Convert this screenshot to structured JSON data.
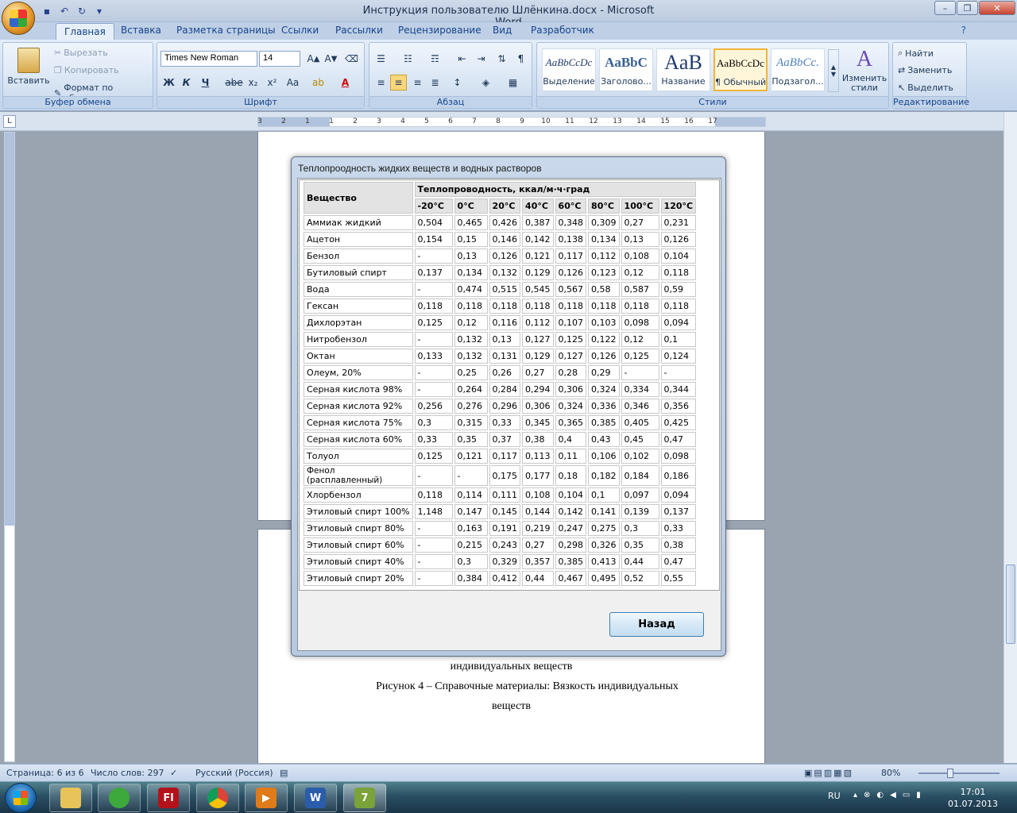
{
  "window": {
    "title": "Инструкция пользователю Шлёнкина.docx - Microsoft Word"
  },
  "tabs": [
    "Главная",
    "Вставка",
    "Разметка страницы",
    "Ссылки",
    "Рассылки",
    "Рецензирование",
    "Вид",
    "Разработчик"
  ],
  "ribbon": {
    "clipboard": {
      "label": "Буфер обмена",
      "paste": "Вставить",
      "cut": "Вырезать",
      "copy": "Копировать",
      "format_painter": "Формат по образцу"
    },
    "font": {
      "label": "Шрифт",
      "family": "Times New Roman",
      "size": "14"
    },
    "paragraph": {
      "label": "Абзац"
    },
    "styles": {
      "label": "Стили",
      "items": [
        {
          "preview": "AaBbCcDc",
          "name": "Выделение"
        },
        {
          "preview": "AaBbC",
          "name": "Заголово..."
        },
        {
          "preview": "AaB",
          "name": "Название"
        },
        {
          "preview": "AaBbCcDc",
          "name": "¶ Обычный"
        },
        {
          "preview": "AaBbCc.",
          "name": "Подзагол..."
        }
      ],
      "change": "Изменить стили"
    },
    "editing": {
      "label": "Редактирование",
      "find": "Найти",
      "replace": "Заменить",
      "select": "Выделить"
    }
  },
  "ruler": {
    "h_ticks": [
      "3",
      "2",
      "1",
      "1",
      "2",
      "3",
      "4",
      "5",
      "6",
      "7",
      "8",
      "9",
      "10",
      "11",
      "12",
      "13",
      "14",
      "15",
      "16",
      "17"
    ],
    "corner": "L"
  },
  "document": {
    "caption_line1": "индивидуальных веществ",
    "caption_line2": "Рисунок 4 – Справочные материалы: Вязкость индивидуальных",
    "caption_line3": "веществ"
  },
  "dialog": {
    "title": "Теплопроодность жидких веществ и водных растворов",
    "col_substance": "Вещество",
    "col_group": "Теплопроводность, ккал/м·ч·град",
    "temps": [
      "-20°C",
      "0°C",
      "20°C",
      "40°C",
      "60°C",
      "80°C",
      "100°C",
      "120°C"
    ],
    "rows": [
      {
        "name": "Аммиак жидкий",
        "v": [
          "0,504",
          "0,465",
          "0,426",
          "0,387",
          "0,348",
          "0,309",
          "0,27",
          "0,231"
        ]
      },
      {
        "name": "Ацетон",
        "v": [
          "0,154",
          "0,15",
          "0,146",
          "0,142",
          "0,138",
          "0,134",
          "0,13",
          "0,126"
        ]
      },
      {
        "name": "Бензол",
        "v": [
          "-",
          "0,13",
          "0,126",
          "0,121",
          "0,117",
          "0,112",
          "0,108",
          "0,104"
        ]
      },
      {
        "name": "Бутиловый спирт",
        "v": [
          "0,137",
          "0,134",
          "0,132",
          "0,129",
          "0,126",
          "0,123",
          "0,12",
          "0,118"
        ]
      },
      {
        "name": "Вода",
        "v": [
          "-",
          "0,474",
          "0,515",
          "0,545",
          "0,567",
          "0,58",
          "0,587",
          "0,59"
        ]
      },
      {
        "name": "Гексан",
        "v": [
          "0,118",
          "0,118",
          "0,118",
          "0,118",
          "0,118",
          "0,118",
          "0,118",
          "0,118"
        ]
      },
      {
        "name": "Дихлорэтан",
        "v": [
          "0,125",
          "0,12",
          "0,116",
          "0,112",
          "0,107",
          "0,103",
          "0,098",
          "0,094"
        ]
      },
      {
        "name": "Нитробензол",
        "v": [
          "-",
          "0,132",
          "0,13",
          "0,127",
          "0,125",
          "0,122",
          "0,12",
          "0,1"
        ]
      },
      {
        "name": "Октан",
        "v": [
          "0,133",
          "0,132",
          "0,131",
          "0,129",
          "0,127",
          "0,126",
          "0,125",
          "0,124"
        ]
      },
      {
        "name": "Олеум, 20%",
        "v": [
          "-",
          "0,25",
          "0,26",
          "0,27",
          "0,28",
          "0,29",
          "-",
          "-"
        ]
      },
      {
        "name": "Серная кислота 98%",
        "v": [
          "-",
          "0,264",
          "0,284",
          "0,294",
          "0,306",
          "0,324",
          "0,334",
          "0,344"
        ]
      },
      {
        "name": "Серная кислота 92%",
        "v": [
          "0,256",
          "0,276",
          "0,296",
          "0,306",
          "0,324",
          "0,336",
          "0,346",
          "0,356"
        ]
      },
      {
        "name": "Серная кислота 75%",
        "v": [
          "0,3",
          "0,315",
          "0,33",
          "0,345",
          "0,365",
          "0,385",
          "0,405",
          "0,425"
        ]
      },
      {
        "name": "Серная кислота 60%",
        "v": [
          "0,33",
          "0,35",
          "0,37",
          "0,38",
          "0,4",
          "0,43",
          "0,45",
          "0,47"
        ]
      },
      {
        "name": "Толуол",
        "v": [
          "0,125",
          "0,121",
          "0,117",
          "0,113",
          "0,11",
          "0,106",
          "0,102",
          "0,098"
        ]
      },
      {
        "name": "Фенол\n(расплавленный)",
        "v": [
          "-",
          "-",
          "0,175",
          "0,177",
          "0,18",
          "0,182",
          "0,184",
          "0,186"
        ]
      },
      {
        "name": "Хлорбензол",
        "v": [
          "0,118",
          "0,114",
          "0,111",
          "0,108",
          "0,104",
          "0,1",
          "0,097",
          "0,094"
        ]
      },
      {
        "name": "Этиловый спирт 100%",
        "v": [
          "1,148",
          "0,147",
          "0,145",
          "0,144",
          "0,142",
          "0,141",
          "0,139",
          "0,137"
        ]
      },
      {
        "name": "Этиловый спирт 80%",
        "v": [
          "-",
          "0,163",
          "0,191",
          "0,219",
          "0,247",
          "0,275",
          "0,3",
          "0,33"
        ]
      },
      {
        "name": "Этиловый спирт 60%",
        "v": [
          "-",
          "0,215",
          "0,243",
          "0,27",
          "0,298",
          "0,326",
          "0,35",
          "0,38"
        ]
      },
      {
        "name": "Этиловый спирт 40%",
        "v": [
          "-",
          "0,3",
          "0,329",
          "0,357",
          "0,385",
          "0,413",
          "0,44",
          "0,47"
        ]
      },
      {
        "name": "Этиловый спирт 20%",
        "v": [
          "-",
          "0,384",
          "0,412",
          "0,44",
          "0,467",
          "0,495",
          "0,52",
          "0,55"
        ]
      }
    ],
    "back": "Назад"
  },
  "status": {
    "page": "Страница: 6 из 6",
    "words": "Число слов: 297",
    "lang": "Русский (Россия)",
    "zoom": "80%"
  },
  "taskbar": {
    "lang": "RU",
    "time": "17:01",
    "date": "01.07.2013"
  }
}
